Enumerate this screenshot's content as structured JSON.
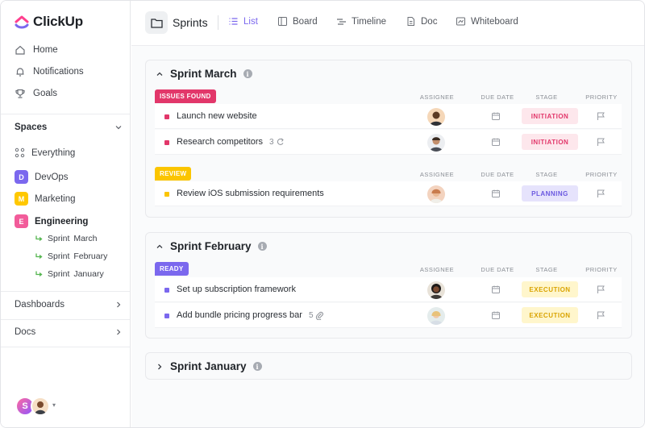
{
  "app": {
    "name": "ClickUp"
  },
  "sidebar": {
    "nav": [
      {
        "label": "Home",
        "icon": "home-icon"
      },
      {
        "label": "Notifications",
        "icon": "bell-icon"
      },
      {
        "label": "Goals",
        "icon": "trophy-icon"
      }
    ],
    "spaces_label": "Spaces",
    "everything_label": "Everything",
    "spaces": [
      {
        "letter": "D",
        "label": "DevOps",
        "color": "#7b68ee"
      },
      {
        "letter": "M",
        "label": "Marketing",
        "color": "#ffc800"
      },
      {
        "letter": "E",
        "label": "Engineering",
        "color": "#f25c9a"
      }
    ],
    "sprints": [
      "Sprint  March",
      "Sprint  February",
      "Sprint  January"
    ],
    "dashboards_label": "Dashboards",
    "docs_label": "Docs",
    "user_initial": "S"
  },
  "header": {
    "title": "Sprints",
    "tabs": [
      {
        "label": "List",
        "active": true
      },
      {
        "label": "Board"
      },
      {
        "label": "Timeline"
      },
      {
        "label": "Doc"
      },
      {
        "label": "Whiteboard"
      }
    ]
  },
  "columns": {
    "assignee": "ASSIGNEE",
    "due": "DUE DATE",
    "stage": "STAGE",
    "priority": "PRIORITY"
  },
  "sprints": [
    {
      "title": "Sprint March",
      "groups": [
        {
          "status": "ISSUES FOUND",
          "color": "#e2376a",
          "tasks": [
            {
              "name": "Launch new website",
              "count": "",
              "stage": "INITIATION"
            },
            {
              "name": "Research competitors",
              "count": "3",
              "stage": "INITIATION"
            }
          ]
        },
        {
          "status": "REVIEW",
          "color": "#fbc500",
          "tasks": [
            {
              "name": "Review iOS submission requirements",
              "count": "",
              "stage": "PLANNING"
            }
          ]
        }
      ]
    },
    {
      "title": "Sprint February",
      "groups": [
        {
          "status": "READY",
          "color": "#7b68ee",
          "tasks": [
            {
              "name": "Set up subscription framework",
              "count": "",
              "stage": "EXECUTION"
            },
            {
              "name": "Add bundle pricing progress bar",
              "count": "5",
              "stage": "EXECUTION"
            }
          ]
        }
      ]
    },
    {
      "title": "Sprint January"
    }
  ],
  "colors": {
    "accent": "#7b68ee",
    "initiation_bg": "#fde7ec",
    "initiation_fg": "#e2376a",
    "planning_bg": "#e6e3fc",
    "planning_fg": "#6a58e0",
    "execution_bg": "#fff6cc",
    "execution_fg": "#d9a300"
  }
}
